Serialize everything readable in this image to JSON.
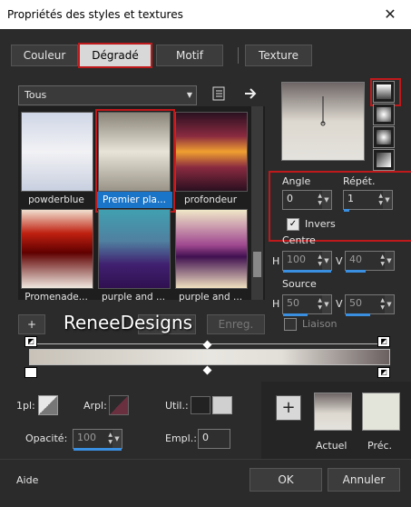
{
  "window": {
    "title": "Propriétés des styles et textures",
    "close": "✕"
  },
  "tabs": [
    {
      "label": "Couleur"
    },
    {
      "label": "Dégradé",
      "active": true
    },
    {
      "label": "Motif"
    },
    {
      "label": "Texture"
    }
  ],
  "gallery": {
    "dropdown_value": "Tous",
    "items": [
      {
        "label": "powderblue"
      },
      {
        "label": "Premier pla...",
        "selected": true
      },
      {
        "label": "profondeur"
      },
      {
        "label": "Promenade..."
      },
      {
        "label": "purple and ..."
      },
      {
        "label": "purple and ..."
      }
    ]
  },
  "settings": {
    "angle_label": "Angle",
    "angle_value": "0",
    "repeat_label": "Répét.",
    "repeat_value": "1",
    "invert_label": "Invers",
    "invert_checked": true,
    "center_label": "Centre",
    "center_h_label": "H",
    "center_h": "100",
    "center_v_label": "V",
    "center_v": "40",
    "source_label": "Source",
    "source_h_label": "H",
    "source_h": "50",
    "source_v_label": "V",
    "source_v": "50",
    "link_label": "Liaison",
    "link_checked": false
  },
  "actions": {
    "add": "+",
    "save": "Enreg."
  },
  "watermark": "ReneeDesigns",
  "stops": {
    "one_pl_label": "1pl:",
    "arpl_label": "Arpl:",
    "util_label": "Util.:",
    "opacity_label": "Opacité:",
    "opacity_value": "100",
    "empl_label": "Empl.:",
    "empl_value": "0"
  },
  "swatches": {
    "add": "+",
    "current_label": "Actuel",
    "previous_label": "Préc."
  },
  "footer": {
    "help": "Aide",
    "ok": "OK",
    "cancel": "Annuler"
  }
}
